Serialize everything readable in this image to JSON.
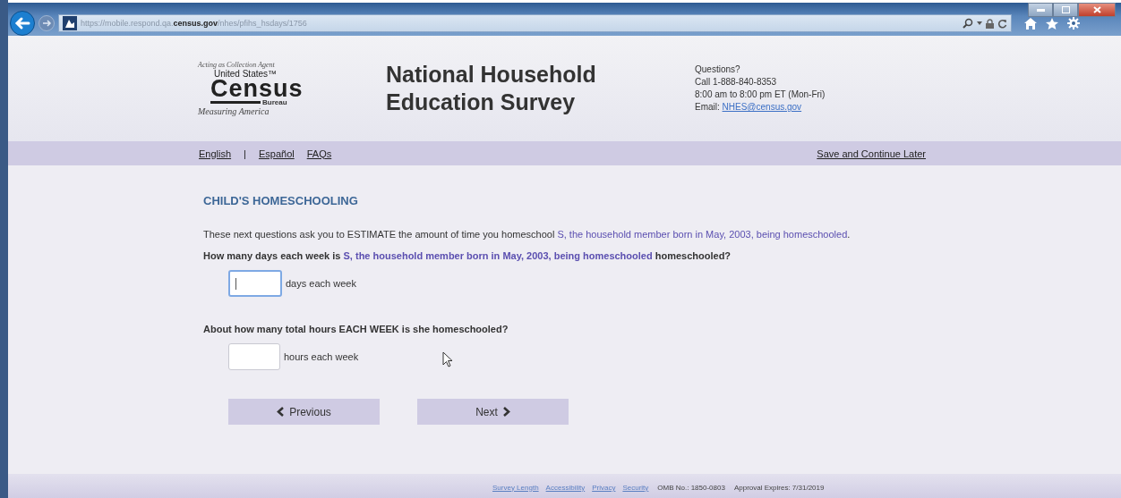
{
  "browser": {
    "url": "https://mobile.respond.qa.**census.gov**/nhes/pfihs_hsdays/1756"
  },
  "header": {
    "logo": {
      "tagline": "Acting as Collection Agent",
      "line1": "United States",
      "tm": "™",
      "name": "Census",
      "bureau": "Bureau",
      "motto": "Measuring America"
    },
    "title": [
      "National Household",
      "Education Survey"
    ],
    "contact": {
      "heading": "Questions?",
      "lines": [
        "Call 1-888-840-8353",
        "8:00 am to 8:00 pm ET (Mon-Fri)"
      ],
      "email_label": "Email:",
      "email": "NHES@census.gov"
    }
  },
  "nav": {
    "links": [
      "English",
      "Español",
      "FAQs"
    ],
    "separator": "|",
    "right_link": "Save and Continue Later"
  },
  "section_title": "CHILD'S HOMESCHOOLING",
  "intro": [
    {
      "kind": "plain",
      "text": "These next questions ask you to ESTIMATE the amount of time you homeschool "
    },
    {
      "kind": "fill",
      "text": "S, the household member born in May, 2003, being homeschooled"
    },
    {
      "kind": "plain",
      "text": "."
    }
  ],
  "questions": [
    {
      "parts": [
        {
          "kind": "plain",
          "text": "How many days each week is "
        },
        {
          "kind": "fill",
          "text": "S, the household member born in May, 2003, being homeschooled"
        },
        {
          "kind": "plain",
          "text": " homeschooled?"
        }
      ],
      "focused": true,
      "unit": "days each week"
    },
    {
      "parts": [
        {
          "kind": "plain",
          "text": "About how many total hours EACH WEEK is she homeschooled?"
        }
      ],
      "focused": false,
      "unit": "hours each week"
    }
  ],
  "buttons": [
    {
      "kind": "previous",
      "label": "Previous"
    },
    {
      "kind": "next",
      "label": "Next"
    }
  ],
  "footer": {
    "links": [
      "Survey Length",
      "Accessibility",
      "Privacy",
      "Security"
    ],
    "texts": [
      "OMB No.: 1850-0803",
      "Approval Expires: 7/31/2019"
    ]
  }
}
